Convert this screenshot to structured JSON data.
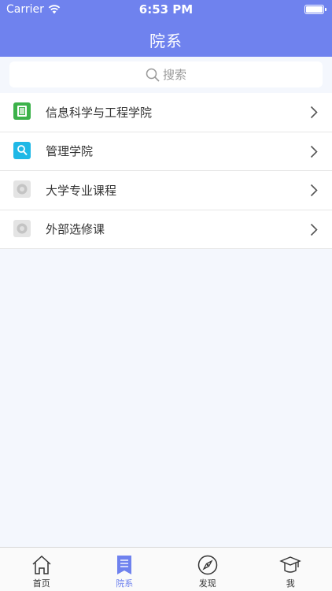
{
  "status_bar": {
    "carrier": "Carrier",
    "time": "6:53 PM"
  },
  "header": {
    "title": "院系"
  },
  "search": {
    "placeholder": "搜索"
  },
  "departments": [
    {
      "label": "信息科学与工程学院",
      "icon": "book-icon",
      "color": "#3cb24a"
    },
    {
      "label": "管理学院",
      "icon": "magnifier-icon",
      "color": "#1fb8e6"
    },
    {
      "label": "大学专业课程",
      "icon": "placeholder-image-icon",
      "color": "#cfcfcf"
    },
    {
      "label": "外部选修课",
      "icon": "placeholder-image-icon",
      "color": "#cfcfcf"
    }
  ],
  "tabs": [
    {
      "label": "首页",
      "icon": "home-icon",
      "active": false
    },
    {
      "label": "院系",
      "icon": "list-bookmark-icon",
      "active": true
    },
    {
      "label": "发现",
      "icon": "compass-icon",
      "active": false
    },
    {
      "label": "我",
      "icon": "graduation-cap-icon",
      "active": false
    }
  ],
  "colors": {
    "accent": "#6f82ee",
    "background": "#f4f7fd"
  }
}
